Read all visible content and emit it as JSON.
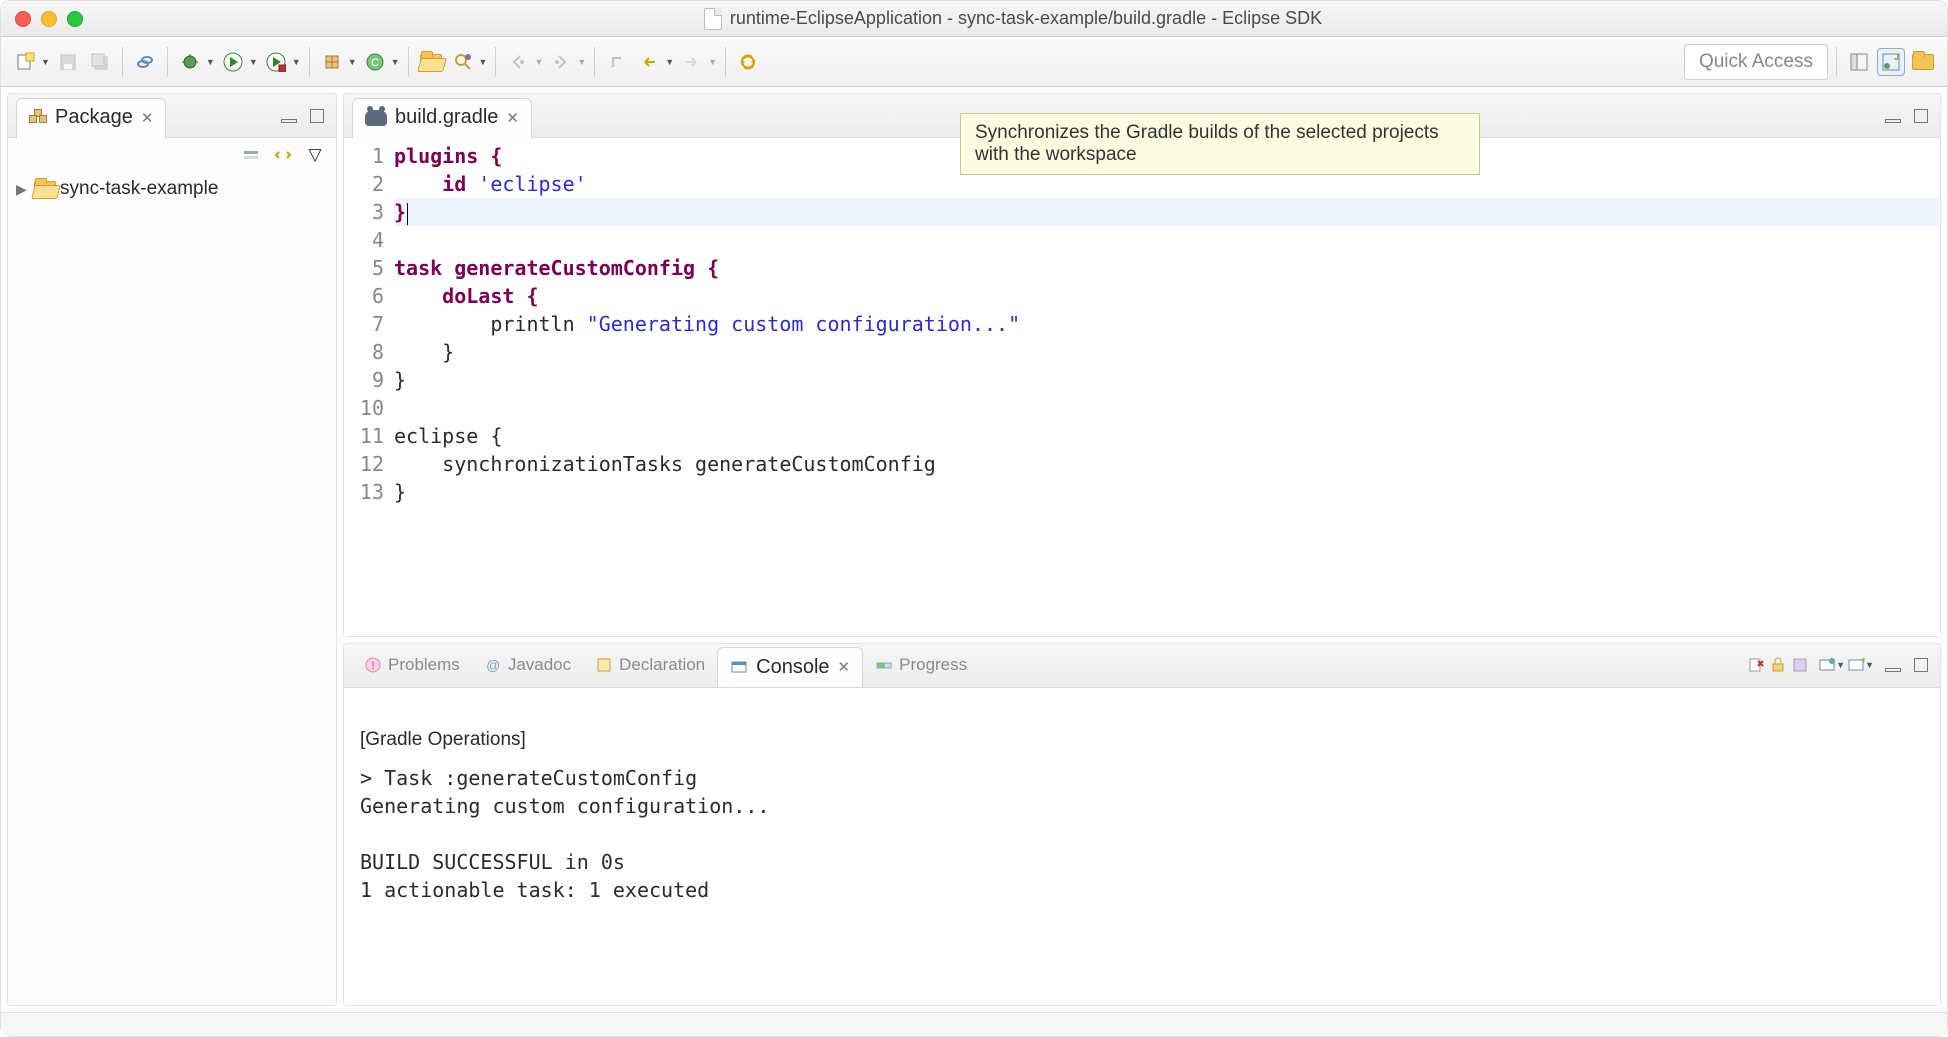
{
  "window": {
    "title": "runtime-EclipseApplication - sync-task-example/build.gradle - Eclipse SDK"
  },
  "toolbar": {
    "quick_access": "Quick Access"
  },
  "tooltip": {
    "text": "Synchronizes the Gradle builds of the selected projects with the workspace"
  },
  "package_explorer": {
    "title": "Package",
    "items": [
      {
        "label": "sync-task-example"
      }
    ]
  },
  "editor": {
    "tab": "build.gradle",
    "lines": [
      {
        "n": "1",
        "tokens": [
          {
            "t": "plugins {",
            "c": "kw"
          }
        ]
      },
      {
        "n": "2",
        "tokens": [
          {
            "t": "    "
          },
          {
            "t": "id ",
            "c": "kw"
          },
          {
            "t": "'eclipse'",
            "c": "str"
          }
        ]
      },
      {
        "n": "3",
        "tokens": [
          {
            "t": "}",
            "c": "kw"
          }
        ],
        "hl": true,
        "caret": true
      },
      {
        "n": "4",
        "tokens": [
          {
            "t": ""
          }
        ]
      },
      {
        "n": "5",
        "tokens": [
          {
            "t": "task generateCustomConfig {",
            "c": "kw"
          }
        ]
      },
      {
        "n": "6",
        "tokens": [
          {
            "t": "    doLast {",
            "c": "kw"
          }
        ]
      },
      {
        "n": "7",
        "tokens": [
          {
            "t": "        println "
          },
          {
            "t": "\"Generating custom configuration...\"",
            "c": "str"
          }
        ]
      },
      {
        "n": "8",
        "tokens": [
          {
            "t": "    }"
          }
        ]
      },
      {
        "n": "9",
        "tokens": [
          {
            "t": "}"
          }
        ]
      },
      {
        "n": "10",
        "tokens": [
          {
            "t": ""
          }
        ]
      },
      {
        "n": "11",
        "tokens": [
          {
            "t": "eclipse {"
          }
        ]
      },
      {
        "n": "12",
        "tokens": [
          {
            "t": "    synchronizationTasks generateCustomConfig"
          }
        ]
      },
      {
        "n": "13",
        "tokens": [
          {
            "t": "}"
          }
        ]
      }
    ]
  },
  "bottom_tabs": {
    "problems": "Problems",
    "javadoc": "Javadoc",
    "declaration": "Declaration",
    "console": "Console",
    "progress": "Progress"
  },
  "console": {
    "label": "[Gradle Operations]",
    "output": "> Task :generateCustomConfig\nGenerating custom configuration...\n\nBUILD SUCCESSFUL in 0s\n1 actionable task: 1 executed"
  }
}
